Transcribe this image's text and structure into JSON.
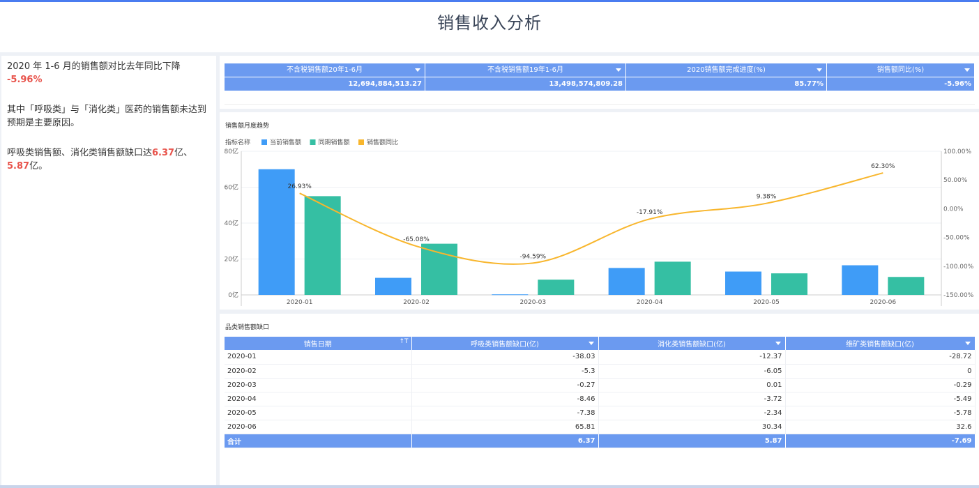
{
  "page": {
    "title": "销售收入分析"
  },
  "summary": {
    "p1_pre": "2020 年 1-6 月的销售额对比去年同比下降 ",
    "p1_val": "-5.96%",
    "p2": "其中「呼吸类」与「消化类」医药的销售额未达到预期是主要原因。",
    "p3_pre": "呼吸类销售额、消化类销售额缺口达",
    "p3_v1": "6.37",
    "p3_mid": "亿、",
    "p3_v2": "5.87",
    "p3_post": "亿。"
  },
  "kpi": {
    "headers": [
      "不含税销售额20年1-6月",
      "不含税销售额19年1-6月",
      "2020销售额完成进度(%)",
      "销售额同比(%)"
    ],
    "values": [
      "12,694,884,513.27",
      "13,498,574,809.28",
      "85.77%",
      "-5.96%"
    ]
  },
  "chart_data": {
    "type": "bar",
    "title": "销售额月度趋势",
    "legend_title": "指标名称",
    "categories": [
      "2020-01",
      "2020-02",
      "2020-03",
      "2020-04",
      "2020-05",
      "2020-06"
    ],
    "series": [
      {
        "name": "当前销售额",
        "type": "bar",
        "axis": "left",
        "color": "#3f9cf7",
        "values": [
          70,
          9.5,
          0.3,
          15,
          13,
          16.5
        ]
      },
      {
        "name": "同期销售额",
        "type": "bar",
        "axis": "left",
        "color": "#35bfa3",
        "values": [
          55,
          28.5,
          8.5,
          18.5,
          12,
          10
        ]
      },
      {
        "name": "销售额同比",
        "type": "line",
        "axis": "right",
        "color": "#f8b62d",
        "values": [
          26.93,
          -65.08,
          -94.59,
          -17.91,
          9.38,
          62.3
        ],
        "labels": [
          "26.93%",
          "-65.08%",
          "-94.59%",
          "-17.91%",
          "9.38%",
          "62.30%"
        ]
      }
    ],
    "y_left": {
      "range": [
        0,
        80
      ],
      "ticks": [
        0,
        20,
        40,
        60,
        80
      ],
      "tick_labels": [
        "0亿",
        "20亿",
        "40亿",
        "60亿",
        "80亿"
      ]
    },
    "y_right": {
      "range": [
        -150,
        100
      ],
      "ticks": [
        100,
        50,
        0,
        -50,
        -100,
        -150
      ],
      "tick_labels": [
        "100.00%",
        "50.00%",
        "0.00%",
        "-50.00%",
        "-100.00%",
        "-150.00%"
      ]
    },
    "grid": true,
    "legend_position": "top-left"
  },
  "table": {
    "title": "品类销售额缺口",
    "headers": [
      "销售日期",
      "呼吸类销售额缺口(亿)",
      "消化类销售额缺口(亿)",
      "维矿类销售额缺口(亿)"
    ],
    "sort_icon": "↑T",
    "rows": [
      [
        "2020-01",
        "-38.03",
        "-12.37",
        "-28.72"
      ],
      [
        "2020-02",
        "-5.3",
        "-6.05",
        "0"
      ],
      [
        "2020-03",
        "-0.27",
        "0.01",
        "-0.29"
      ],
      [
        "2020-04",
        "-8.46",
        "-3.72",
        "-5.49"
      ],
      [
        "2020-05",
        "-7.38",
        "-2.34",
        "-5.78"
      ],
      [
        "2020-06",
        "65.81",
        "30.34",
        "32.6"
      ]
    ],
    "total": [
      "合计",
      "6.37",
      "5.87",
      "-7.69"
    ]
  }
}
